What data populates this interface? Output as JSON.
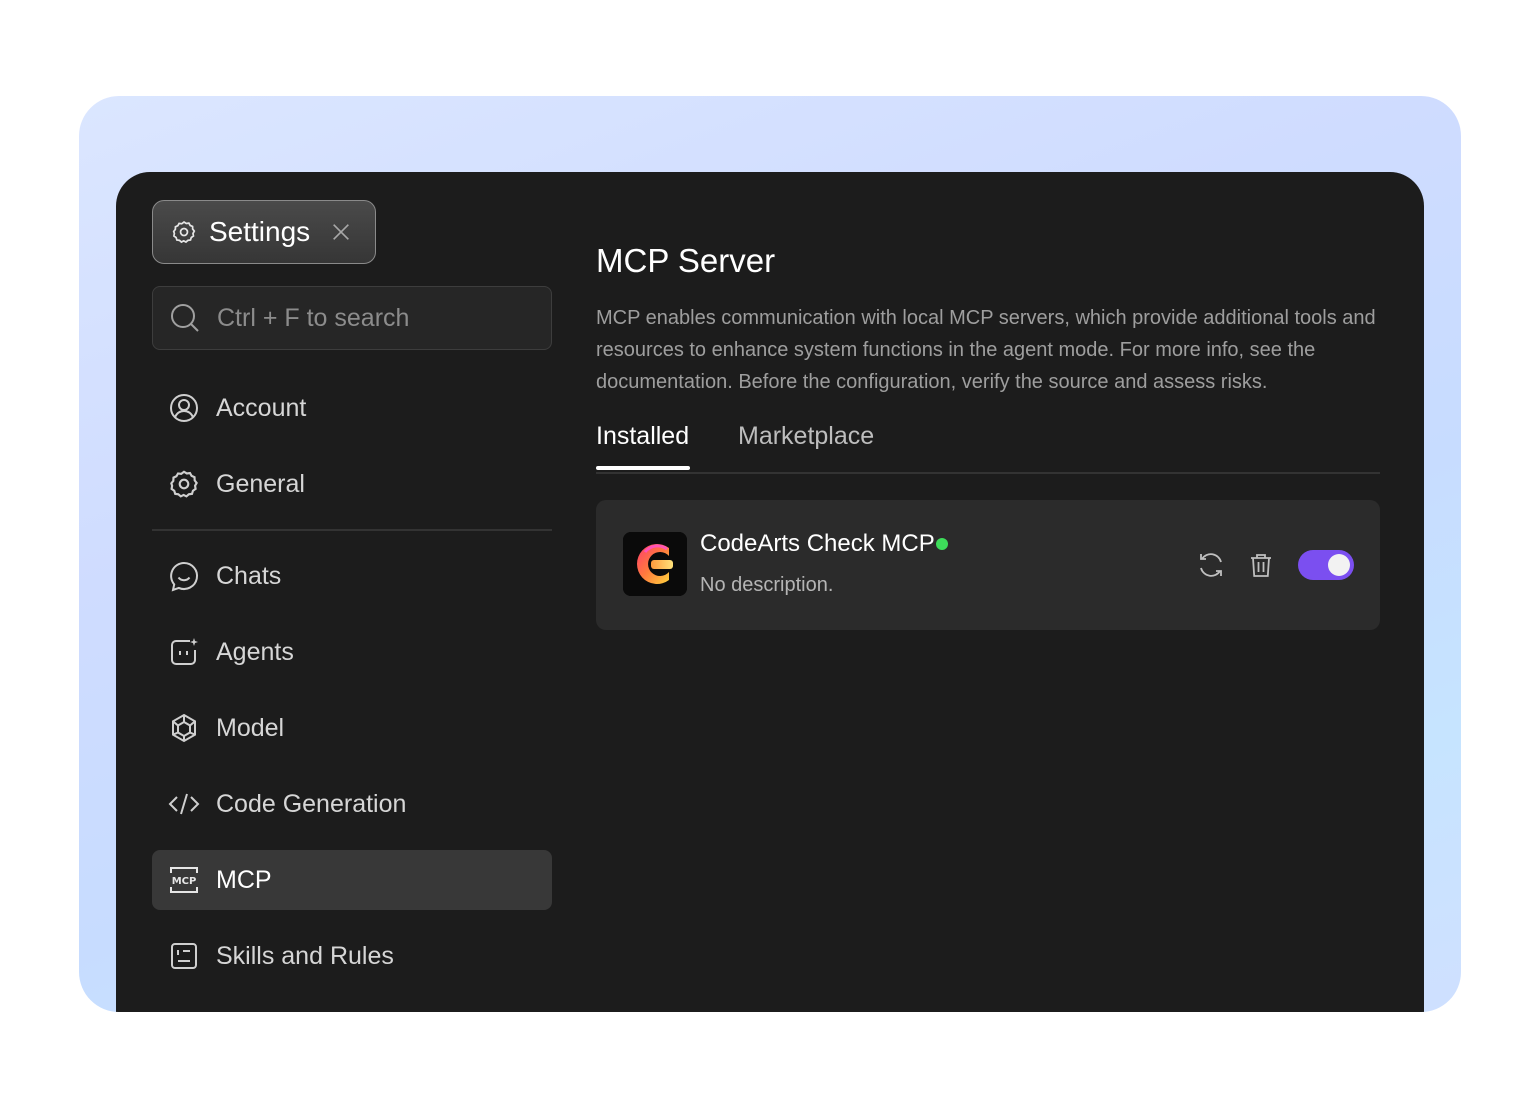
{
  "settings_tab": {
    "title": "Settings"
  },
  "search": {
    "placeholder": "Ctrl + F to search"
  },
  "sidebar": {
    "items": [
      {
        "label": "Account",
        "icon": "user-circle-icon"
      },
      {
        "label": "General",
        "icon": "gear-icon"
      },
      {
        "label": "Chats",
        "icon": "chat-bubble-icon"
      },
      {
        "label": "Agents",
        "icon": "agent-sparkle-icon"
      },
      {
        "label": "Model",
        "icon": "model-hexagon-icon"
      },
      {
        "label": "Code Generation",
        "icon": "code-icon"
      },
      {
        "label": "MCP",
        "icon": "mcp-icon",
        "active": true
      },
      {
        "label": "Skills and Rules",
        "icon": "rules-list-icon"
      }
    ]
  },
  "main": {
    "title": "MCP Server",
    "description": "MCP enables communication with local MCP servers, which provide additional tools and resources to enhance system functions in the agent mode. For more info, see the documentation. Before the configuration, verify the source and assess risks.",
    "tabs": [
      {
        "label": "Installed",
        "active": true
      },
      {
        "label": "Marketplace",
        "active": false
      }
    ],
    "servers": [
      {
        "name": "CodeArts Check MCP",
        "description": "No description.",
        "status": "running",
        "status_color": "#3ddc5a",
        "enabled": true
      }
    ]
  },
  "colors": {
    "accent_toggle": "#7b4ff0",
    "window_bg": "#1c1c1c",
    "active_nav_bg": "#383838"
  }
}
